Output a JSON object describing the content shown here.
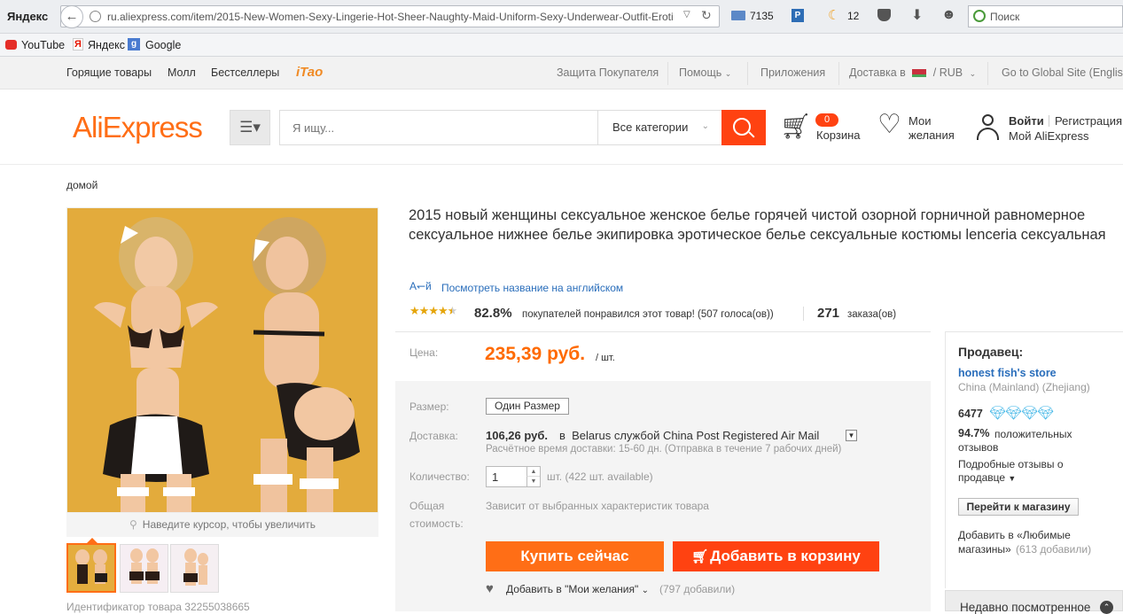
{
  "browser": {
    "yandex_label": "Яндекс",
    "url": "ru.aliexpress.com/item/2015-New-Women-Sexy-Lingerie-Hot-Sheer-Naughty-Maid-Uniform-Sexy-Underwear-Outfit-Eroti",
    "mail_count": "7135",
    "weather": "12",
    "search_placeholder": "Поиск",
    "bookmarks": [
      "YouTube",
      "Яндекс",
      "Google"
    ]
  },
  "topnav": {
    "left": [
      "Горящие товары",
      "Молл",
      "Бестселлеры"
    ],
    "itao": "iTao",
    "buyer_protection": "Защита Покупателя",
    "help": "Помощь",
    "apps": "Приложения",
    "ship_to": "Доставка в",
    "currency": "/ RUB",
    "global": "Go to Global Site (English)"
  },
  "header": {
    "logo": "AliExpress",
    "search_placeholder": "Я ищу...",
    "category": "Все категории",
    "cart_count": "0",
    "cart_label": "Корзина",
    "wishlist_line1": "Мои",
    "wishlist_line2": "желания",
    "login": "Войти",
    "register": "Регистрация",
    "my_ali": "Мой AliExpress"
  },
  "breadcrumb": "домой",
  "gallery": {
    "zoom_hint": "Наведите курсор, чтобы увеличить",
    "product_id": "Идентификатор товара 32255038665"
  },
  "product": {
    "title": "2015 новый женщины сексуальное женское белье горячей чистой озорной горничной равномерное сексуальное нижнее белье экипировка эротическое белье сексуальные костюмы lenceria сексуальная",
    "translate_link": "Посмотреть название на английском",
    "rating_percent": "82.8%",
    "rating_text": "покупателей понравился этот товар! (507 голоса(ов))",
    "rating_stars": 4.5,
    "orders_count": "271",
    "orders_label": "заказа(ов)",
    "price_label": "Цена:",
    "price": "235,39 руб.",
    "price_unit": "/ шт.",
    "size_label": "Размер:",
    "size_value": "Один Размер",
    "delivery_label": "Доставка:",
    "delivery_price": "106,26 руб.",
    "delivery_text": "в  Belarus службой China Post Registered Air Mail",
    "delivery_time": "Расчётное время доставки: 15-60 дн. (Отправка в течение 7 рабочих дней)",
    "qty_label": "Количество:",
    "qty_value": "1",
    "qty_available": "шт. (422 шт. available)",
    "total_label_1": "Общая",
    "total_label_2": "стоимость:",
    "total_text": "Зависит от выбранных характеристик товара",
    "buy_now": "Купить сейчас",
    "add_to_cart": "Добавить в корзину",
    "wishlist": "Добавить в \"Мои желания\"",
    "wishlist_count": "(797 добавили)"
  },
  "seller": {
    "heading": "Продавец:",
    "store_name": "honest fish's store",
    "location": "China (Mainland) (Zhejiang)",
    "score": "6477",
    "positive_percent": "94.7%",
    "positive_text_1": "положительных",
    "positive_text_2": "отзывов",
    "detailed_1": "Подробные отзывы о",
    "detailed_2": "продавце",
    "goto_store": "Перейти к магазину",
    "fav_1": "Добавить в «Любимые",
    "fav_2": "магазины»",
    "fav_count": "(613 добавили)"
  },
  "recently_viewed": "Недавно посмотренное",
  "colors": {
    "accent": "#ff6e16",
    "price": "#ff6a00",
    "link": "#2a6ebb",
    "cart_red": "#ff4211"
  }
}
